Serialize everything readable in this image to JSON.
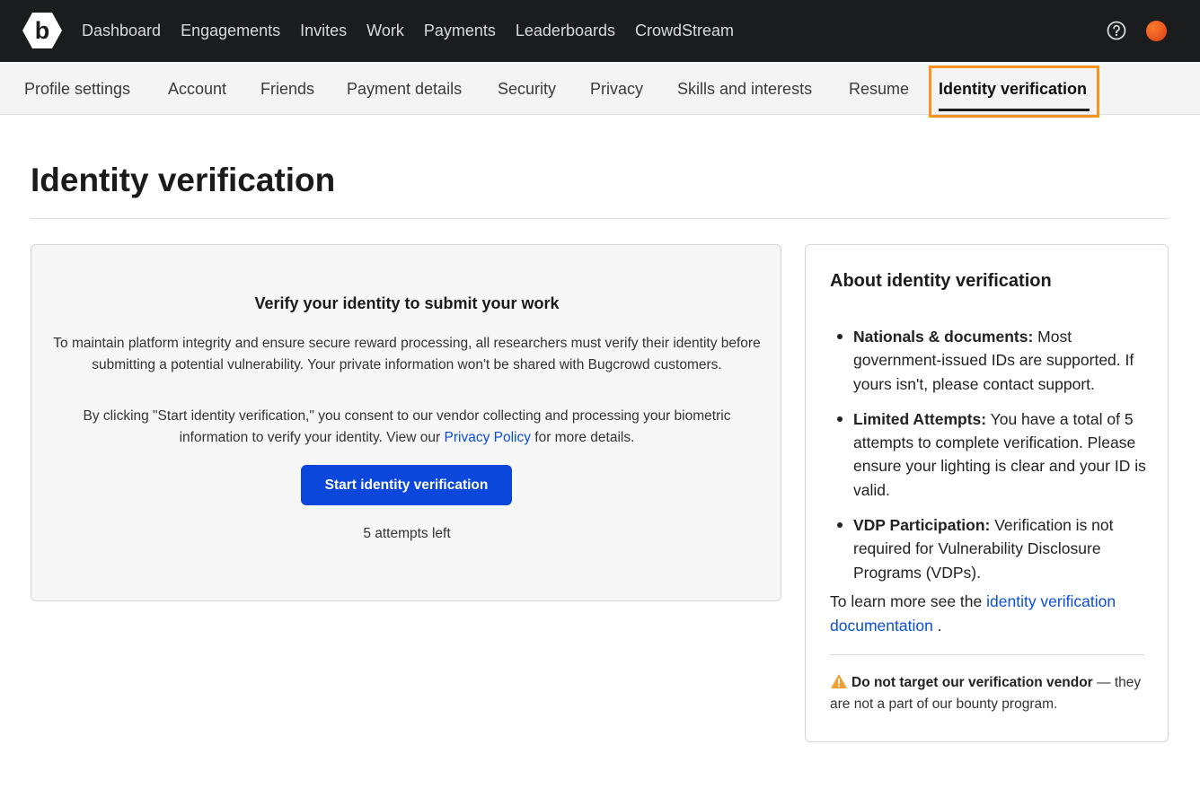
{
  "topnav": {
    "logo_letter": "b",
    "items": [
      "Dashboard",
      "Engagements",
      "Invites",
      "Work",
      "Payments",
      "Leaderboards",
      "CrowdStream"
    ],
    "help_icon": "help-circle-icon",
    "avatar_color": "#e6501a"
  },
  "subnav": {
    "tabs": [
      "Profile settings",
      "Account",
      "Friends",
      "Payment details",
      "Security",
      "Privacy",
      "Skills and interests",
      "Resume",
      "Identity verification"
    ],
    "active": "Identity verification",
    "highlight_color": "#f7931e"
  },
  "page": {
    "title": "Identity verification"
  },
  "verify": {
    "heading": "Verify your identity to submit your work",
    "p1": "To maintain platform integrity and ensure secure reward processing, all researchers must verify their identity before submitting a potential vulnerability. Your private information won't be shared with Bugcrowd customers.",
    "p2_before": "By clicking \"Start identity verification,\" you consent to our vendor collecting and processing your biometric information to verify your identity. View our ",
    "p2_link": "Privacy Policy",
    "p2_after": " for more details.",
    "button_label": "Start identity verification",
    "button_color": "#0b47db",
    "attempts_text": "5 attempts left"
  },
  "about": {
    "title": "About identity verification",
    "items": [
      {
        "label": "Nationals & documents:",
        "text": " Most government-issued IDs are supported. If yours isn't, please contact support."
      },
      {
        "label": "Limited Attempts:",
        "text": " You have a total of 5 attempts to complete verification. Please ensure your lighting is clear and your ID is valid."
      },
      {
        "label": "VDP Participation:",
        "text": " Verification is not required for Vulnerability Disclosure Programs (VDPs)."
      }
    ],
    "learn_before": "To learn more see the ",
    "learn_link": "identity verification documentation",
    "learn_after": " .",
    "warning_bold": "Do not target our verification vendor",
    "warning_text": " — they are not a part of our bounty program.",
    "warning_icon": "warning-triangle-icon",
    "warning_color": "#f0a030",
    "link_color": "#0b4fd6"
  }
}
